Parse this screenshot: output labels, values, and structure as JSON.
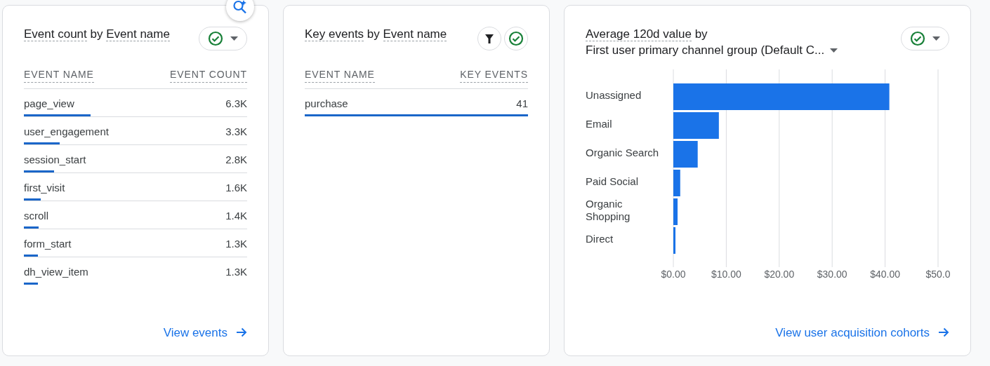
{
  "cards": [
    {
      "title": {
        "metric": "Event count",
        "joiner": "by",
        "dimension": "Event name"
      },
      "controls": [
        {
          "kind": "check"
        },
        {
          "kind": "caret"
        }
      ],
      "insights_button": true,
      "table": {
        "columns": [
          "EVENT NAME",
          "EVENT COUNT"
        ],
        "rows": [
          {
            "name": "page_view",
            "value": "6.3K",
            "level": 0.3
          },
          {
            "name": "user_engagement",
            "value": "3.3K",
            "level": 0.16
          },
          {
            "name": "session_start",
            "value": "2.8K",
            "level": 0.135
          },
          {
            "name": "first_visit",
            "value": "1.6K",
            "level": 0.075
          },
          {
            "name": "scroll",
            "value": "1.4K",
            "level": 0.066
          },
          {
            "name": "form_start",
            "value": "1.3K",
            "level": 0.062
          },
          {
            "name": "dh_view_item",
            "value": "1.3K",
            "level": 0.062
          }
        ]
      },
      "footer_link": "View events"
    },
    {
      "title": {
        "metric": "Key events",
        "joiner": "by",
        "dimension": "Event name"
      },
      "controls": [
        {
          "kind": "filter"
        },
        {
          "kind": "check"
        }
      ],
      "table": {
        "columns": [
          "EVENT NAME",
          "KEY EVENTS"
        ],
        "rows": [
          {
            "name": "purchase",
            "value": "41",
            "level": 1.0
          }
        ]
      }
    },
    {
      "title": {
        "metric": "Average 120d value",
        "joiner": "by",
        "dimension": "First user primary channel group (Default C..."
      },
      "controls": [
        {
          "kind": "check"
        },
        {
          "kind": "caret"
        }
      ],
      "chart_data": {
        "type": "bar",
        "orientation": "horizontal",
        "categories": [
          "Unassigned",
          "Email",
          "Organic Search",
          "Paid Social",
          "Organic Shopping",
          "Direct"
        ],
        "series": [
          {
            "color": "#1a73e8",
            "values": [
              40.8,
              8.6,
              4.6,
              1.3,
              0.8,
              0.4
            ]
          }
        ],
        "xlim": [
          0,
          50
        ],
        "grid": true,
        "xticks": [
          {
            "value": 0,
            "label": "$0.00"
          },
          {
            "value": 10,
            "label": "$10.00"
          },
          {
            "value": 20,
            "label": "$20.00"
          },
          {
            "value": 30,
            "label": "$30.00"
          },
          {
            "value": 40,
            "label": "$40.00"
          },
          {
            "value": 50,
            "label": "$50.0"
          }
        ]
      },
      "footer_link": "View user acquisition cohorts"
    }
  ]
}
